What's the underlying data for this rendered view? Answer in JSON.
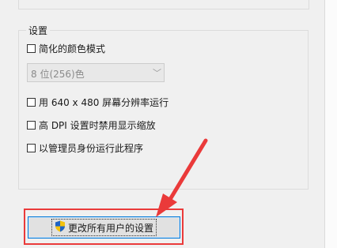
{
  "settings": {
    "title": "设置",
    "reduced_color": {
      "label": "简化的颜色模式",
      "checked": false
    },
    "color_depth": {
      "selected": "8 位(256)色"
    },
    "low_res": {
      "label": "用 640 x 480 屏幕分辨率运行",
      "checked": false
    },
    "high_dpi": {
      "label": "高 DPI 设置时禁用显示缩放",
      "checked": false
    },
    "admin": {
      "label": "以管理员身份运行此程序",
      "checked": false
    }
  },
  "change_all_users_button": {
    "label": "更改所有用户的设置",
    "icon": "shield-icon"
  },
  "annotation": {
    "color": "#ea3a3a"
  }
}
